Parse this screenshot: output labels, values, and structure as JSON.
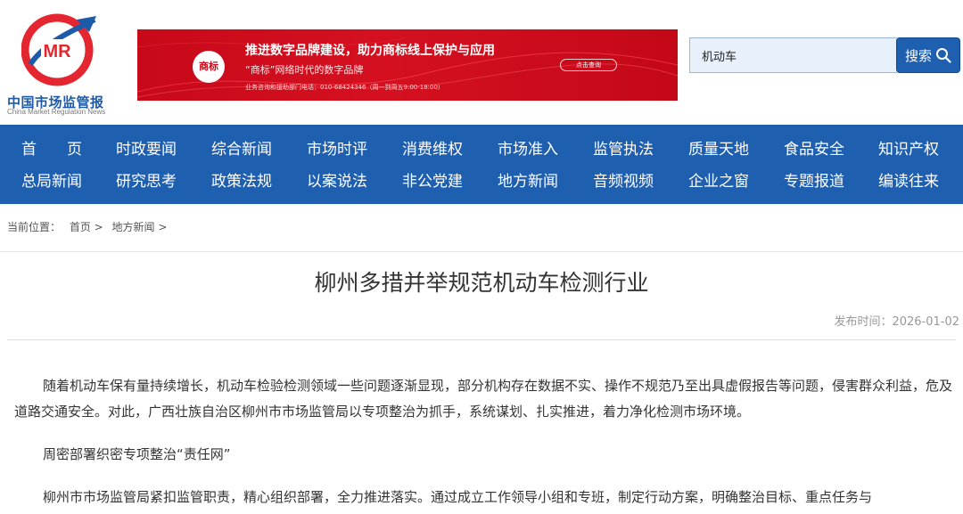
{
  "logo": {
    "name_cn": "中国市场监管报",
    "name_en": "China Market Regulation News",
    "mark_text": "MR"
  },
  "banner": {
    "badge": "商标",
    "title": "推进数字品牌建设，助力商标线上保护与应用",
    "subtitle": "“商标”网络时代的数字品牌",
    "small_text": "业务咨询和援助部门电话：010-68424346（周一到周五9:00-18:00）",
    "button": "点击查询"
  },
  "search": {
    "value": "机动车",
    "button_label": "搜索"
  },
  "nav": {
    "row1": [
      "首　　页",
      "时政要闻",
      "综合新闻",
      "市场时评",
      "消费维权",
      "市场准入",
      "监管执法",
      "质量天地",
      "食品安全",
      "知识产权"
    ],
    "row2": [
      "总局新闻",
      "研究思考",
      "政策法规",
      "以案说法",
      "非公党建",
      "地方新闻",
      "音频视频",
      "企业之窗",
      "专题报道",
      "编读往来"
    ]
  },
  "breadcrumb": {
    "prefix": "当前位置：",
    "items": [
      "首页 >",
      "地方新闻 >"
    ]
  },
  "article": {
    "title": "柳州多措并举规范机动车检测行业",
    "date": "发布时间：2026-01-02",
    "paragraphs": [
      "随着机动车保有量持续增长，机动车检验检测领域一些问题逐渐显现，部分机构存在数据不实、操作不规范乃至出具虚假报告等问题，侵害群众利益，危及道路交通安全。对此，广西壮族自治区柳州市市场监管局以专项整治为抓手，系统谋划、扎实推进，着力净化检测市场环境。",
      "周密部署织密专项整治“责任网”",
      "柳州市市场监管局紧扣监管职责，精心组织部署，全力推进落实。通过成立工作领导小组和专班，制定行动方案，明确整治目标、重点任务与"
    ]
  },
  "colors": {
    "brand_blue": "#1f5fb0",
    "banner_red": "#c8091a",
    "logo_red": "#e3262f"
  }
}
